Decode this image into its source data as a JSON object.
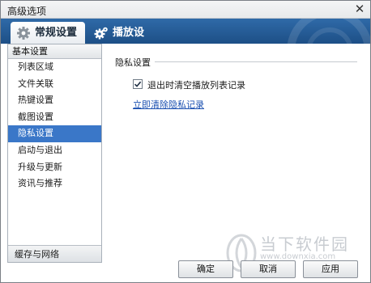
{
  "window": {
    "title": "高级选项",
    "close_glyph": "✕"
  },
  "tabs": [
    {
      "label": "常规设置",
      "icon": "gear-icon",
      "active": true
    },
    {
      "label": "播放设置",
      "icon": "gears-icon",
      "active": false
    }
  ],
  "sidebar": {
    "header": "基本设置",
    "items": [
      {
        "label": "列表区域"
      },
      {
        "label": "文件关联"
      },
      {
        "label": "热键设置"
      },
      {
        "label": "截图设置"
      },
      {
        "label": "隐私设置",
        "active": true
      },
      {
        "label": "启动与退出"
      },
      {
        "label": "升级与更新"
      },
      {
        "label": "资讯与推荐"
      }
    ],
    "footer": "缓存与网络"
  },
  "content": {
    "section_title": "隐私设置",
    "checkbox_label": "退出时清空播放列表记录",
    "checkbox_checked": true,
    "clear_link": "立即清除隐私记录"
  },
  "buttons": {
    "ok": "确定",
    "cancel": "取消",
    "apply": "应用"
  },
  "watermark": {
    "text": "当下软件园",
    "url": "www.downxia.com"
  },
  "colors": {
    "tab_bar": "#2f6aa8",
    "selected_item": "#3a77c8",
    "link": "#1a4fb0"
  }
}
